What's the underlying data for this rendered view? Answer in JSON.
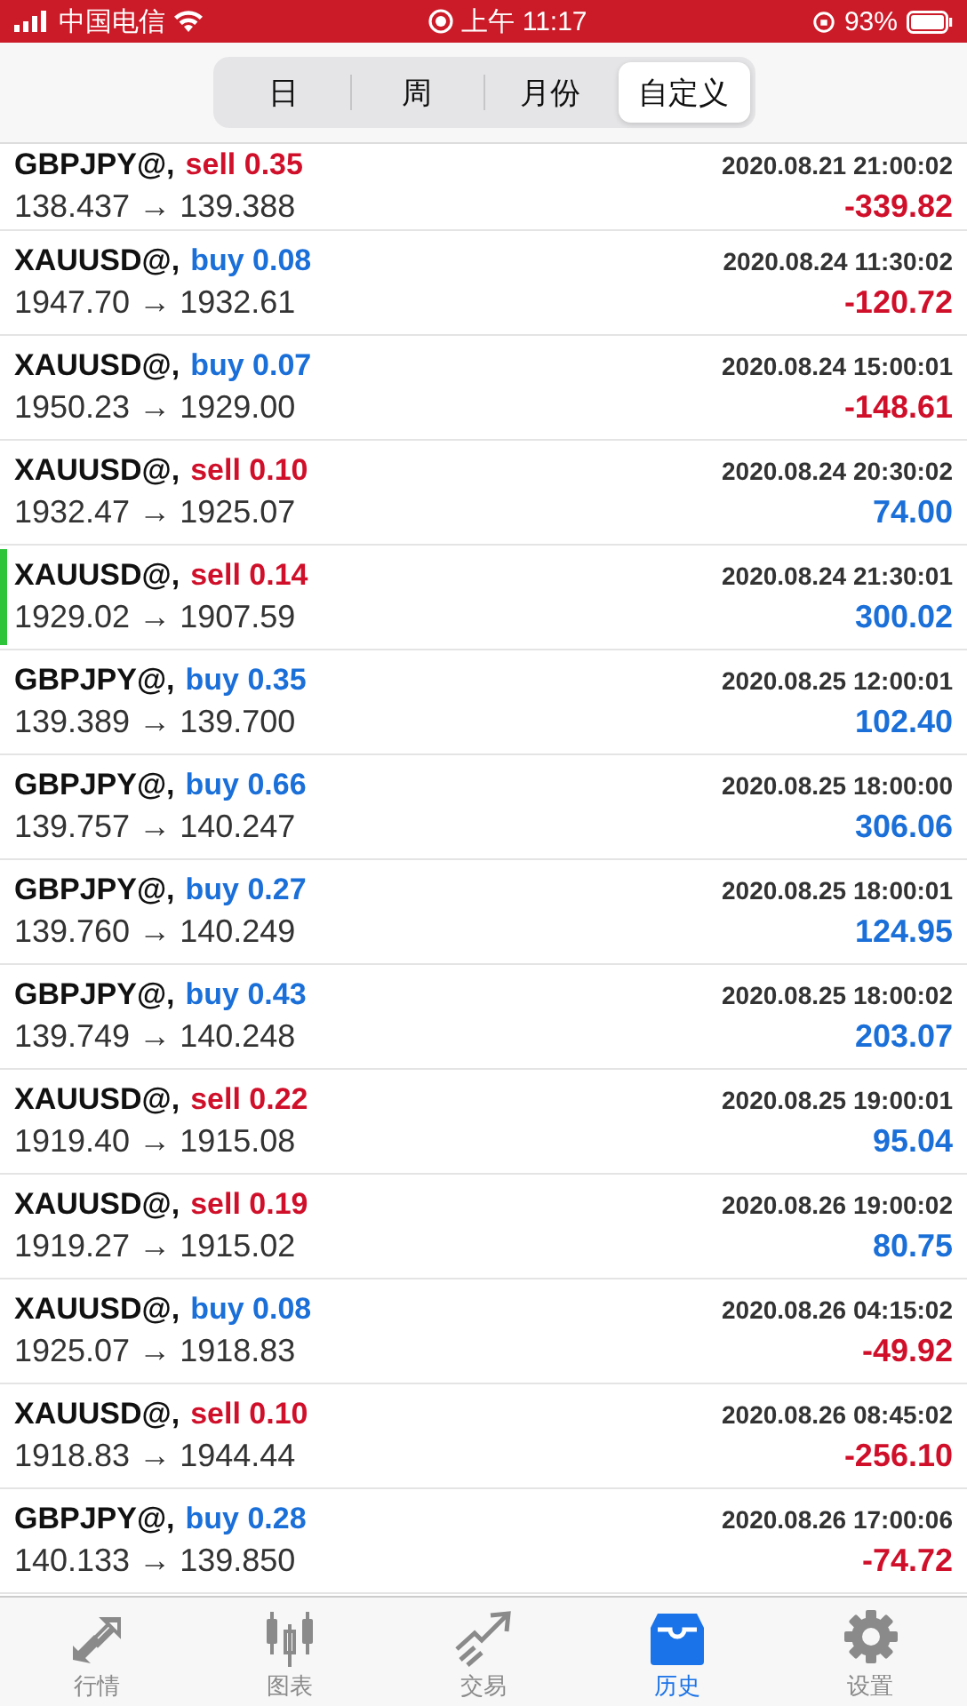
{
  "status_bar": {
    "carrier": "中国电信",
    "time": "上午 11:17",
    "battery": "93%"
  },
  "segments": [
    {
      "label": "日",
      "selected": false
    },
    {
      "label": "周",
      "selected": false
    },
    {
      "label": "月份",
      "selected": false
    },
    {
      "label": "自定义",
      "selected": true
    }
  ],
  "trades": [
    {
      "symbol": "GBPJPY@,",
      "sell": true,
      "action": "sell 0.35",
      "time": "2020.08.21 21:00:02",
      "prices": "138.437 → 139.388",
      "profit": "-339.82",
      "loss": true,
      "selected": false
    },
    {
      "symbol": "XAUUSD@,",
      "sell": false,
      "action": "buy 0.08",
      "time": "2020.08.24 11:30:02",
      "prices": "1947.70 → 1932.61",
      "profit": "-120.72",
      "loss": true,
      "selected": false
    },
    {
      "symbol": "XAUUSD@,",
      "sell": false,
      "action": "buy 0.07",
      "time": "2020.08.24 15:00:01",
      "prices": "1950.23 → 1929.00",
      "profit": "-148.61",
      "loss": true,
      "selected": false
    },
    {
      "symbol": "XAUUSD@,",
      "sell": true,
      "action": "sell 0.10",
      "time": "2020.08.24 20:30:02",
      "prices": "1932.47 → 1925.07",
      "profit": "74.00",
      "loss": false,
      "selected": false
    },
    {
      "symbol": "XAUUSD@,",
      "sell": true,
      "action": "sell 0.14",
      "time": "2020.08.24 21:30:01",
      "prices": "1929.02 → 1907.59",
      "profit": "300.02",
      "loss": false,
      "selected": true
    },
    {
      "symbol": "GBPJPY@,",
      "sell": false,
      "action": "buy 0.35",
      "time": "2020.08.25 12:00:01",
      "prices": "139.389 → 139.700",
      "profit": "102.40",
      "loss": false,
      "selected": false
    },
    {
      "symbol": "GBPJPY@,",
      "sell": false,
      "action": "buy 0.66",
      "time": "2020.08.25 18:00:00",
      "prices": "139.757 → 140.247",
      "profit": "306.06",
      "loss": false,
      "selected": false
    },
    {
      "symbol": "GBPJPY@,",
      "sell": false,
      "action": "buy 0.27",
      "time": "2020.08.25 18:00:01",
      "prices": "139.760 → 140.249",
      "profit": "124.95",
      "loss": false,
      "selected": false
    },
    {
      "symbol": "GBPJPY@,",
      "sell": false,
      "action": "buy 0.43",
      "time": "2020.08.25 18:00:02",
      "prices": "139.749 → 140.248",
      "profit": "203.07",
      "loss": false,
      "selected": false
    },
    {
      "symbol": "XAUUSD@,",
      "sell": true,
      "action": "sell 0.22",
      "time": "2020.08.25 19:00:01",
      "prices": "1919.40 → 1915.08",
      "profit": "95.04",
      "loss": false,
      "selected": false
    },
    {
      "symbol": "XAUUSD@,",
      "sell": true,
      "action": "sell 0.19",
      "time": "2020.08.26 19:00:02",
      "prices": "1919.27 → 1915.02",
      "profit": "80.75",
      "loss": false,
      "selected": false
    },
    {
      "symbol": "XAUUSD@,",
      "sell": false,
      "action": "buy 0.08",
      "time": "2020.08.26 04:15:02",
      "prices": "1925.07 → 1918.83",
      "profit": "-49.92",
      "loss": true,
      "selected": false
    },
    {
      "symbol": "XAUUSD@,",
      "sell": true,
      "action": "sell 0.10",
      "time": "2020.08.26 08:45:02",
      "prices": "1918.83 → 1944.44",
      "profit": "-256.10",
      "loss": true,
      "selected": false
    },
    {
      "symbol": "GBPJPY@,",
      "sell": false,
      "action": "buy 0.28",
      "time": "2020.08.26 17:00:06",
      "prices": "140.133 → 139.850",
      "profit": "-74.72",
      "loss": true,
      "selected": false
    }
  ],
  "tab_bar": [
    {
      "kind": "quotes",
      "label": "行情",
      "selected": false
    },
    {
      "kind": "chart",
      "label": "图表",
      "selected": false
    },
    {
      "kind": "trade",
      "label": "交易",
      "selected": false
    },
    {
      "kind": "history",
      "label": "历史",
      "selected": true
    },
    {
      "kind": "settings",
      "label": "设置",
      "selected": false
    }
  ]
}
